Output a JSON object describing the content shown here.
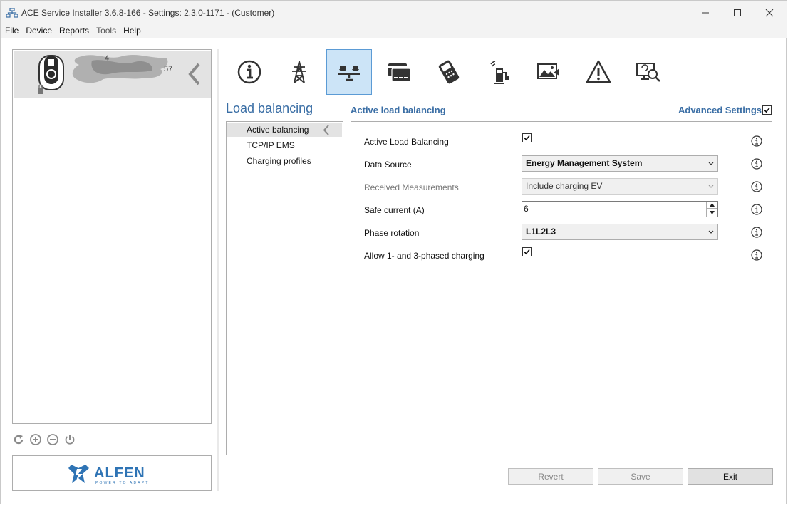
{
  "window": {
    "title": "ACE Service Installer 3.6.8-166 - Settings: 2.3.0-1171 -  (Customer)"
  },
  "menu": [
    "File",
    "Device",
    "Reports",
    "Tools",
    "Help"
  ],
  "device": {
    "text1": "4",
    "text2": "57"
  },
  "logo": {
    "brand": "ALFEN",
    "tagline": "POWER TO ADAPT"
  },
  "toolbar_icons": [
    "info-icon",
    "power-pylon-icon",
    "load-balancing-icon",
    "card-icon",
    "payment-terminal-icon",
    "wireless-charger-icon",
    "display-image-icon",
    "warning-icon",
    "diagnostics-icon"
  ],
  "page": {
    "title": "Load balancing",
    "subtitle": "Active load balancing",
    "advanced_label": "Advanced Settings",
    "advanced_checked": true
  },
  "subnav": [
    "Active balancing",
    "TCP/IP EMS",
    "Charging profiles"
  ],
  "settings": {
    "active_lb_label": "Active Load Balancing",
    "data_source_label": "Data Source",
    "data_source_value": "Energy Management System",
    "received_label": "Received Measurements",
    "received_value": "Include charging EV",
    "safe_current_label": "Safe current (A)",
    "safe_current_value": "6",
    "phase_label": "Phase rotation",
    "phase_value": "L1L2L3",
    "allow_label": "Allow 1- and 3-phased charging"
  },
  "buttons": {
    "revert": "Revert",
    "save": "Save",
    "exit": "Exit"
  },
  "colors": {
    "accent": "#3a6ea5",
    "active_tab": "#cce4f7",
    "brand": "#2f74b5"
  }
}
